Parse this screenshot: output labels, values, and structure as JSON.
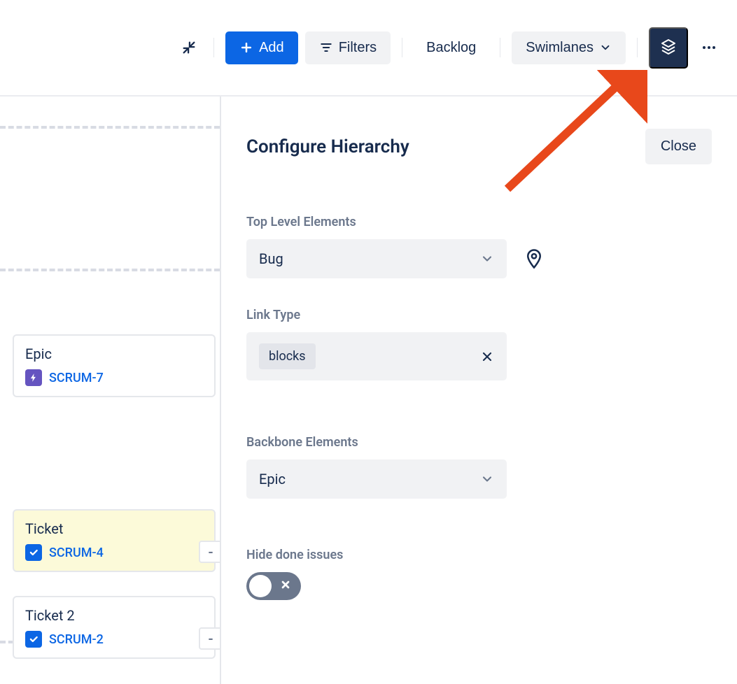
{
  "toolbar": {
    "add_label": "Add",
    "filters_label": "Filters",
    "backlog_label": "Backlog",
    "swimlanes_label": "Swimlanes"
  },
  "panel": {
    "title": "Configure Hierarchy",
    "close_label": "Close",
    "sections": {
      "top_level_label": "Top Level Elements",
      "top_level_value": "Bug",
      "link_type_label": "Link Type",
      "link_type_chip": "blocks",
      "backbone_label": "Backbone Elements",
      "backbone_value": "Epic",
      "hide_done_label": "Hide done issues"
    }
  },
  "cards": {
    "epic": {
      "title": "Epic",
      "key": "SCRUM-7"
    },
    "ticket1": {
      "title": "Ticket",
      "key": "SCRUM-4",
      "btn": "-"
    },
    "ticket2": {
      "title": "Ticket 2",
      "key": "SCRUM-2",
      "btn": "-"
    }
  }
}
